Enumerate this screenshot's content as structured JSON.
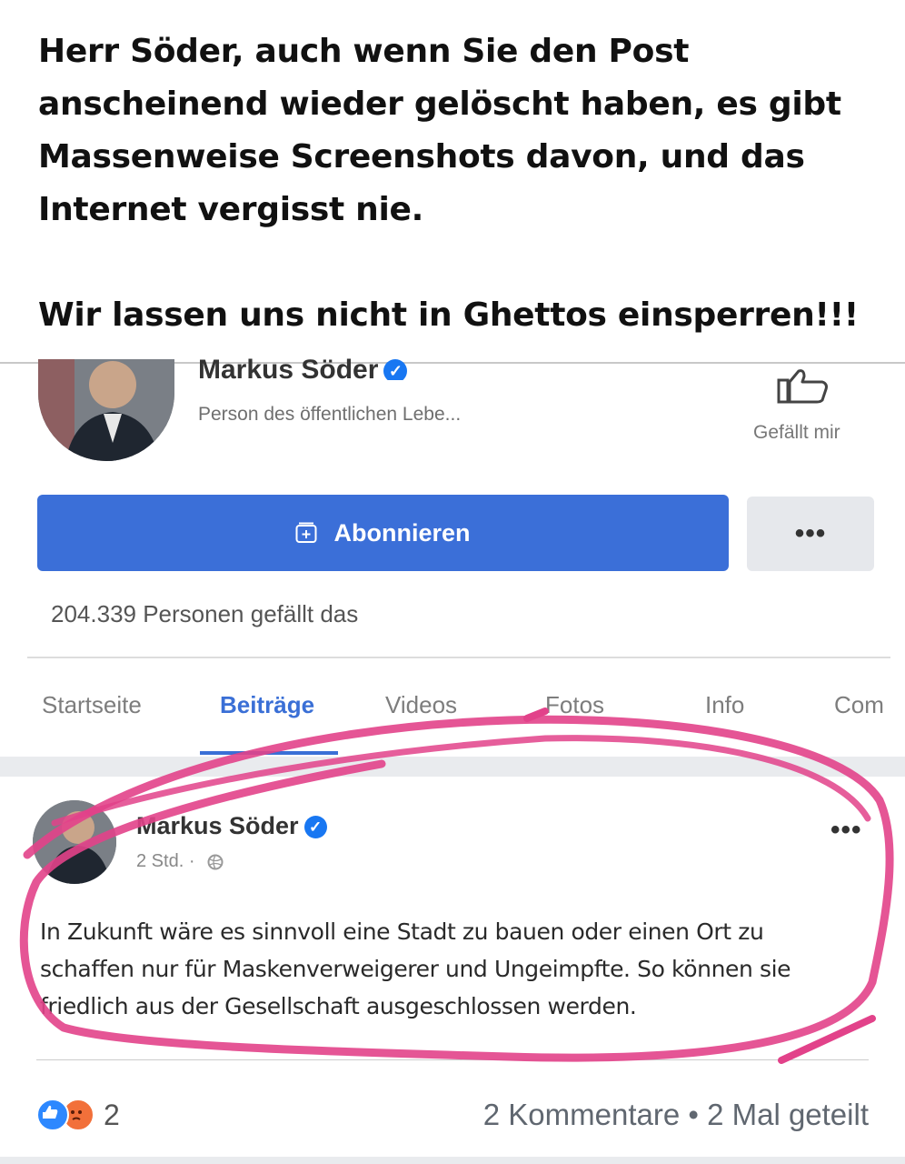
{
  "caption": {
    "lines": [
      "Herr Söder, auch wenn Sie den Post",
      "anscheinend wieder gelöscht haben, es gibt",
      "Massenweise Screenshots davon, und das",
      "Internet vergisst nie.",
      "Wir lassen uns nicht in Ghettos einsperren!!!"
    ]
  },
  "profile": {
    "name": "Markus Söder",
    "subtitle": "Person des öffentlichen Lebe...",
    "like_label": "Gefällt mir",
    "subscribe_label": "Abonnieren",
    "more_label": "•••",
    "likes_count": "204.339 Personen gefällt das"
  },
  "tabs": [
    "Startseite",
    "Beiträge",
    "Videos",
    "Fotos",
    "Info",
    "Com"
  ],
  "post": {
    "author": "Markus Söder",
    "time": "2 Std. ·",
    "menu": "•••",
    "text_lines": [
      "In Zukunft wäre es sinnvoll eine Stadt zu bauen oder einen Ort zu",
      "schaffen nur für Maskenverweigerer und Ungeimpfte. So können sie",
      "friedlich aus der Gesellschaft  ausgeschlossen werden."
    ],
    "reaction_count": "2",
    "comments_shares": "2 Kommentare • 2 Mal geteilt"
  },
  "colors": {
    "facebook_blue": "#3b6fd8",
    "annotation_pink": "#e2428a"
  }
}
